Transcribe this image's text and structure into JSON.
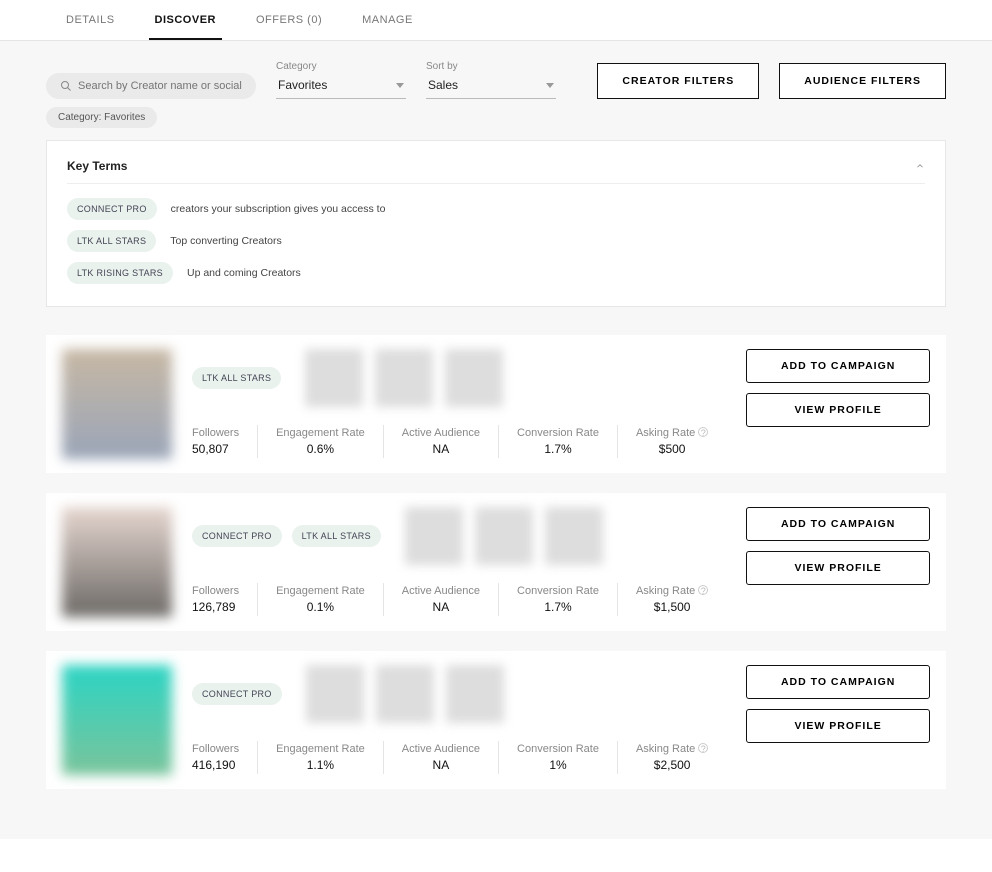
{
  "tabs": {
    "details": "DETAILS",
    "discover": "DISCOVER",
    "offers": "OFFERS (0)",
    "manage": "MANAGE"
  },
  "search": {
    "placeholder": "Search by Creator name or social handle"
  },
  "category": {
    "label": "Category",
    "value": "Favorites"
  },
  "sort": {
    "label": "Sort by",
    "value": "Sales"
  },
  "buttons": {
    "creator_filters": "CREATOR FILTERS",
    "audience_filters": "AUDIENCE FILTERS",
    "add_to_campaign": "ADD TO CAMPAIGN",
    "view_profile": "VIEW PROFILE"
  },
  "filter_chip": "Category: Favorites",
  "keyterms": {
    "title": "Key Terms",
    "rows": [
      {
        "badge": "CONNECT PRO",
        "desc": "creators your subscription gives you access to"
      },
      {
        "badge": "LTK ALL STARS",
        "desc": "Top converting Creators"
      },
      {
        "badge": "LTK RISING STARS",
        "desc": "Up and coming Creators"
      }
    ]
  },
  "stat_labels": {
    "followers": "Followers",
    "engagement": "Engagement Rate",
    "audience": "Active Audience",
    "conversion": "Conversion Rate",
    "asking": "Asking Rate"
  },
  "creators": [
    {
      "badges": [
        "LTK ALL STARS"
      ],
      "followers": "50,807",
      "engagement": "0.6%",
      "audience": "NA",
      "conversion": "1.7%",
      "asking": "$500"
    },
    {
      "badges": [
        "CONNECT PRO",
        "LTK ALL STARS"
      ],
      "followers": "126,789",
      "engagement": "0.1%",
      "audience": "NA",
      "conversion": "1.7%",
      "asking": "$1,500"
    },
    {
      "badges": [
        "CONNECT PRO"
      ],
      "followers": "416,190",
      "engagement": "1.1%",
      "audience": "NA",
      "conversion": "1%",
      "asking": "$2,500"
    }
  ]
}
